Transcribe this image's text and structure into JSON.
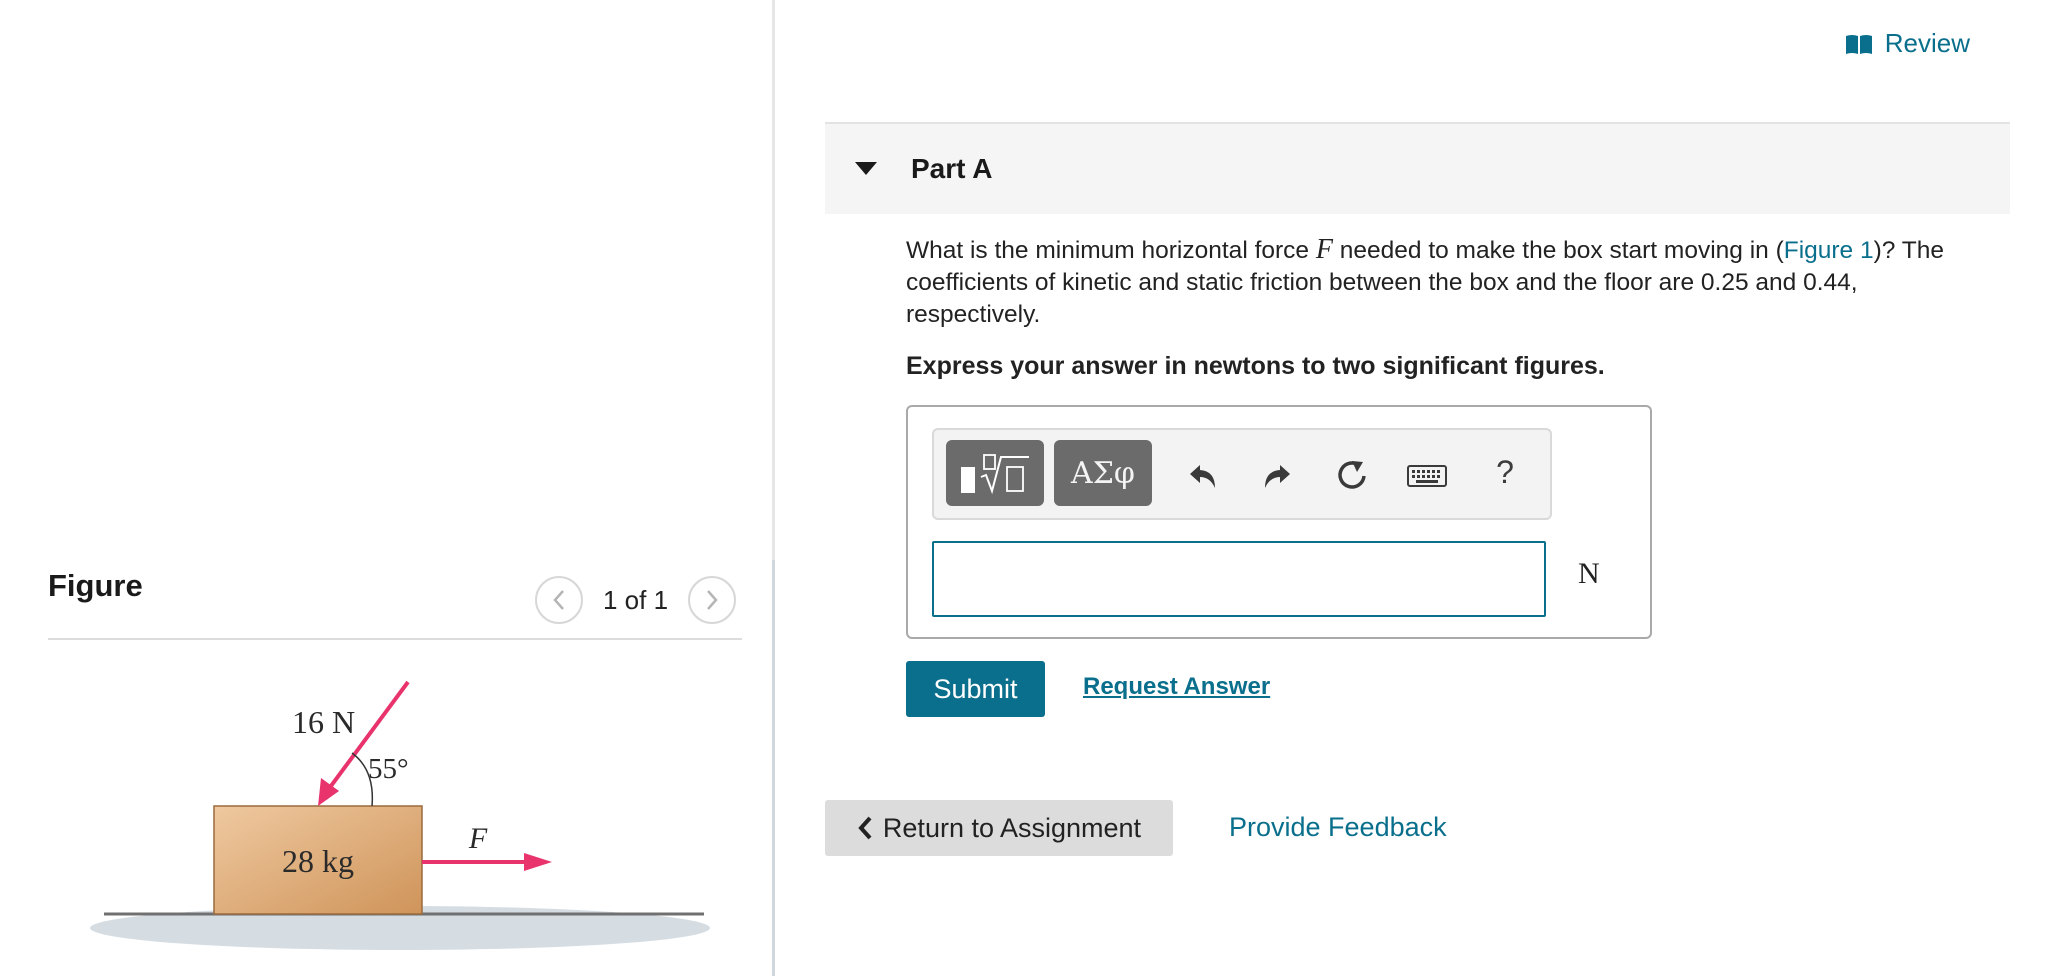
{
  "header": {
    "review_label": "Review",
    "review_icon": "book-icon"
  },
  "figure": {
    "title": "Figure",
    "pager": "1 of 1",
    "prev_icon": "chevron-left-icon",
    "next_icon": "chevron-right-icon",
    "labels": {
      "applied_force": "16 N",
      "angle": "55°",
      "mass": "28 kg",
      "force_var": "F"
    },
    "colors": {
      "arrow": "#e8336d",
      "box": "#d9a46b",
      "floor_shadow": "#d5dde3"
    }
  },
  "part": {
    "title": "Part A",
    "toggle_icon": "caret-down-icon",
    "question_before": "What is the minimum horizontal force ",
    "question_var": "F",
    "question_middle": " needed to make the box start moving in (",
    "figure_link": "Figure 1",
    "question_after": ")? The coefficients of kinetic and static friction between the box and the floor are 0.25 and 0.44, respectively.",
    "instruction": "Express your answer in newtons to two significant figures."
  },
  "toolbar": {
    "templates_icon": "templates-icon",
    "symbols_label": "ΑΣφ",
    "undo_icon": "undo-icon",
    "redo_icon": "redo-icon",
    "reset_icon": "reset-icon",
    "keyboard_icon": "keyboard-icon",
    "help_label": "?"
  },
  "answer": {
    "value": "",
    "unit": "N"
  },
  "actions": {
    "submit_label": "Submit",
    "request_label": "Request Answer",
    "return_label": "Return to Assignment",
    "feedback_label": "Provide Feedback"
  },
  "accent_color": "#0a6f8c"
}
